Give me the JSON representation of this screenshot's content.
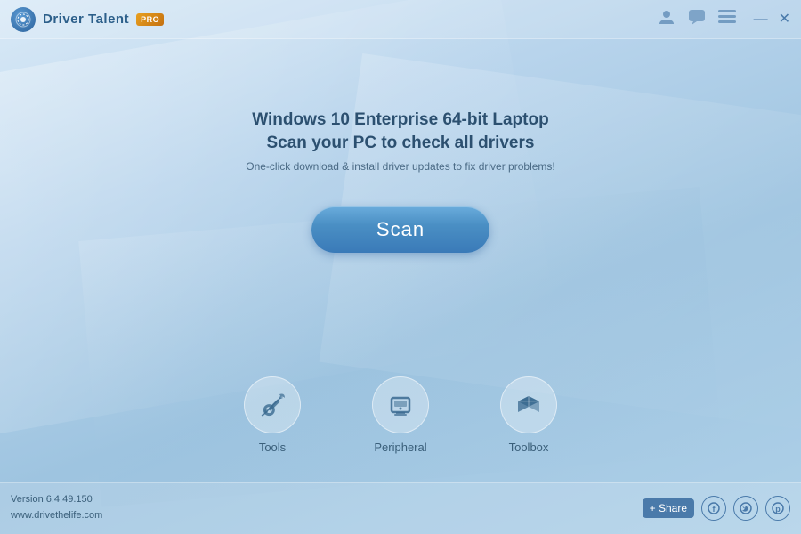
{
  "app": {
    "icon_label": "DT",
    "title": "Driver Talent",
    "pro_badge": "PRO"
  },
  "titlebar": {
    "user_icon": "👤",
    "chat_icon": "💬",
    "list_icon": "☰",
    "minimize": "—",
    "close": "✕"
  },
  "main": {
    "system_line1": "Windows 10 Enterprise 64-bit Laptop",
    "system_line2": "Scan your PC to check all drivers",
    "description": "One-click download & install driver updates to fix driver problems!",
    "scan_button": "Scan"
  },
  "bottom_icons": [
    {
      "id": "tools",
      "label": "Tools"
    },
    {
      "id": "peripheral",
      "label": "Peripheral"
    },
    {
      "id": "toolbox",
      "label": "Toolbox"
    }
  ],
  "footer": {
    "version": "Version 6.4.49.150",
    "website": "www.drivethelife.com",
    "share_label": "+ Share"
  },
  "social": {
    "facebook": "f",
    "twitter": "t",
    "pinterest": "p"
  }
}
